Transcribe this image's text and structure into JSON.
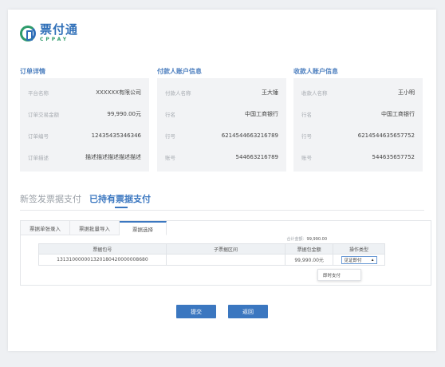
{
  "logo": {
    "name_cn": "票付通",
    "name_en": "CPPAY"
  },
  "sections": {
    "order": {
      "title": "订单详情",
      "rows": [
        {
          "k": "平台名称",
          "v": "XXXXXX有限公司"
        },
        {
          "k": "订单交易金额",
          "v": "99,990.00元"
        },
        {
          "k": "订单编号",
          "v": "12435435346346"
        },
        {
          "k": "订单描述",
          "v": "描述描述描述描述描述"
        }
      ]
    },
    "payer": {
      "title": "付款人账户信息",
      "rows": [
        {
          "k": "付款人名称",
          "v": "王大锤"
        },
        {
          "k": "行名",
          "v": "中国工商银行"
        },
        {
          "k": "行号",
          "v": "6214544663216789"
        },
        {
          "k": "账号",
          "v": "544663216789"
        }
      ]
    },
    "payee": {
      "title": "收款人账户信息",
      "rows": [
        {
          "k": "收款人名称",
          "v": "王小明"
        },
        {
          "k": "行名",
          "v": "中国工商银行"
        },
        {
          "k": "行号",
          "v": "6214544635657752"
        },
        {
          "k": "账号",
          "v": "544635657752"
        }
      ]
    }
  },
  "payment_tabs": [
    "新签发票据支付",
    "已持有票据支付"
  ],
  "sub_tabs": [
    "票据单张录入",
    "票据批量导入",
    "票据选择"
  ],
  "total": {
    "label": "合计金额：",
    "value": "99,990.00"
  },
  "table": {
    "headers": [
      "票据包号",
      "子票据区间",
      "票据包金额",
      "操作类型"
    ],
    "row": {
      "package_no": "131310000001320180420000008680",
      "range": "",
      "amount": "99,990.00元",
      "op": "见证即付"
    }
  },
  "dropdown_option": "即时支付",
  "buttons": {
    "submit": "提交",
    "back": "返回"
  }
}
